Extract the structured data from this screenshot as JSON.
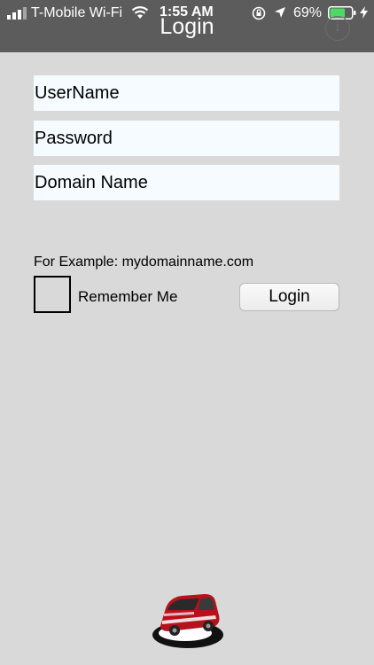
{
  "status_bar": {
    "carrier": "T-Mobile Wi-Fi",
    "time": "1:55 AM",
    "battery_percent": "69%",
    "battery_level": 0.69,
    "battery_color": "#4cd964",
    "icons": [
      "signal-icon",
      "wifi-icon",
      "rotation-lock-icon",
      "location-icon",
      "battery-icon",
      "charging-bolt-icon"
    ]
  },
  "nav": {
    "title": "Login",
    "info_icon": "info-icon",
    "info_glyph": "i"
  },
  "form": {
    "username_placeholder": "UserName",
    "password_placeholder": "Password",
    "domain_placeholder": "Domain Name",
    "example_text": "For Example: mydomainname.com",
    "remember_label": "Remember Me",
    "remember_checked": false,
    "login_label": "Login"
  },
  "footer": {
    "logo_icon": "car-logo-icon"
  }
}
